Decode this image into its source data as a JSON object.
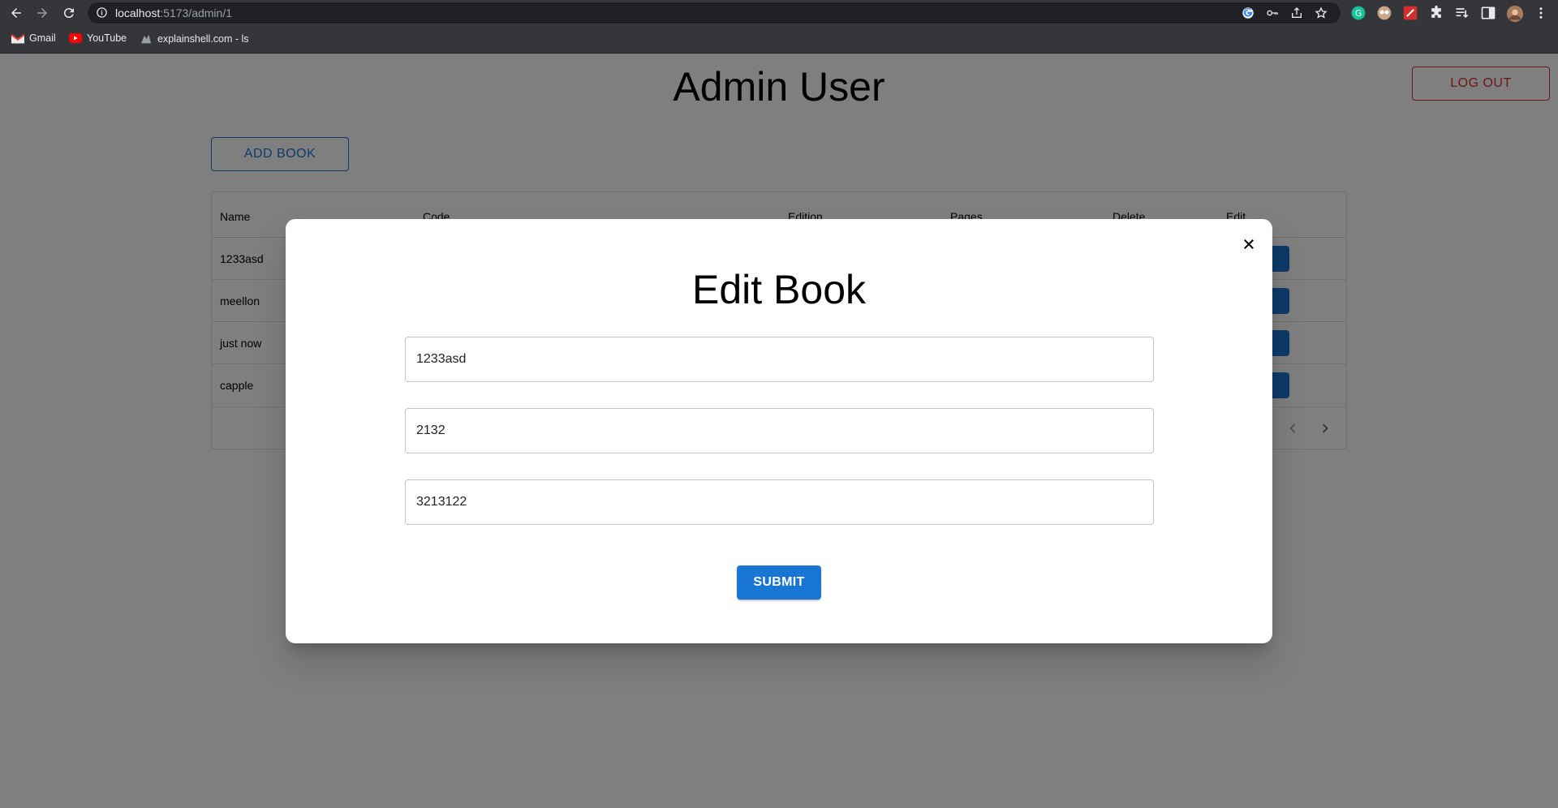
{
  "browser": {
    "url_host": "localhost",
    "url_path": ":5173/admin/1",
    "bookmarks": [
      {
        "label": "Gmail"
      },
      {
        "label": "YouTube"
      },
      {
        "label": "explainshell.com - ls"
      }
    ]
  },
  "page": {
    "title": "Admin User",
    "logout_label": "LOG OUT",
    "add_book_label": "ADD BOOK"
  },
  "table": {
    "headers": [
      "Name",
      "Code",
      "Edition",
      "Pages",
      "Delete",
      "Edit"
    ],
    "rows": [
      {
        "name": "1233asd"
      },
      {
        "name": "meellon"
      },
      {
        "name": "just now"
      },
      {
        "name": "capple"
      }
    ]
  },
  "modal": {
    "title": "Edit Book",
    "fields": [
      "1233asd",
      "2132",
      "3213122"
    ],
    "submit_label": "SUBMIT"
  },
  "colors": {
    "primary": "#1976d2",
    "danger": "#d32f2f"
  }
}
